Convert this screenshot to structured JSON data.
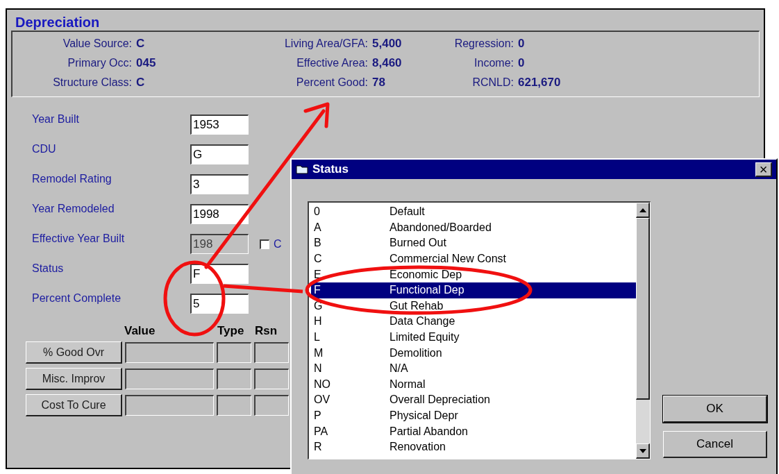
{
  "window": {
    "title": "Depreciation"
  },
  "summary": [
    [
      {
        "label": "Value Source:",
        "value": "C"
      },
      {
        "label": "Primary Occ:",
        "value": "045"
      },
      {
        "label": "Structure Class:",
        "value": "C"
      }
    ],
    [
      {
        "label": "Living Area/GFA:",
        "value": "5,400"
      },
      {
        "label": "Effective Area:",
        "value": "8,460"
      },
      {
        "label": "Percent Good:",
        "value": "78"
      }
    ],
    [
      {
        "label": "Regression:",
        "value": "0"
      },
      {
        "label": "Income:",
        "value": "0"
      },
      {
        "label": "RCNLD:",
        "value": "621,670"
      }
    ]
  ],
  "fields": [
    {
      "label": "Year Built",
      "value": "1953",
      "disabled": false
    },
    {
      "label": "CDU",
      "value": "G",
      "disabled": false
    },
    {
      "label": "Remodel Rating",
      "value": "3",
      "disabled": false
    },
    {
      "label": "Year Remodeled",
      "value": "1998",
      "disabled": false
    },
    {
      "label": "Effective Year Built",
      "value": "198",
      "disabled": true,
      "checkbox": {
        "label": "C",
        "checked": false
      }
    },
    {
      "label": "Status",
      "value": "F",
      "disabled": false
    },
    {
      "label": "Percent Complete",
      "value": "5",
      "disabled": false
    }
  ],
  "overrides": {
    "columns": [
      "Value",
      "Type",
      "Rsn"
    ],
    "rows": [
      "% Good Ovr",
      "Misc. Improv",
      "Cost To Cure"
    ]
  },
  "dialog": {
    "title": "Status",
    "close": "×",
    "items": [
      {
        "code": "0",
        "description": "Default",
        "selected": false
      },
      {
        "code": "A",
        "description": "Abandoned/Boarded",
        "selected": false
      },
      {
        "code": "B",
        "description": "Burned Out",
        "selected": false
      },
      {
        "code": "C",
        "description": "Commercial New Const",
        "selected": false
      },
      {
        "code": "E",
        "description": "Economic Dep",
        "selected": false
      },
      {
        "code": "F",
        "description": "Functional Dep",
        "selected": true
      },
      {
        "code": "G",
        "description": "Gut Rehab",
        "selected": false
      },
      {
        "code": "H",
        "description": "Data Change",
        "selected": false
      },
      {
        "code": "L",
        "description": "Limited Equity",
        "selected": false
      },
      {
        "code": "M",
        "description": "Demolition",
        "selected": false
      },
      {
        "code": "N",
        "description": "N/A",
        "selected": false
      },
      {
        "code": "NO",
        "description": "Normal",
        "selected": false
      },
      {
        "code": "OV",
        "description": "Overall Depreciation",
        "selected": false
      },
      {
        "code": "P",
        "description": "Physical Depr",
        "selected": false
      },
      {
        "code": "PA",
        "description": "Partial Abandon",
        "selected": false
      },
      {
        "code": "R",
        "description": "Renovation",
        "selected": false
      }
    ],
    "buttons": [
      "OK",
      "Cancel"
    ]
  }
}
